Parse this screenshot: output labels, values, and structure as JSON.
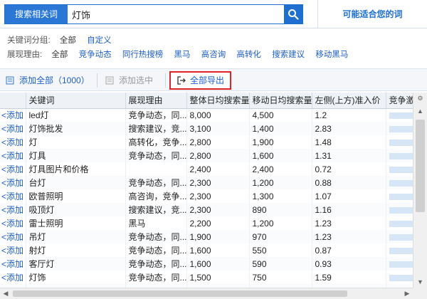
{
  "search": {
    "label": "搜索相关词",
    "value": "灯饰",
    "button_icon": "search-icon"
  },
  "right_tab": {
    "label": "可能适合您的词"
  },
  "filters": {
    "group": {
      "label": "关键词分组:",
      "all": "全部",
      "items": [
        "自定义"
      ]
    },
    "reason": {
      "label": "展现理由:",
      "all": "全部",
      "items": [
        "竞争动态",
        "同行热搜榜",
        "黑马",
        "高咨询",
        "高转化",
        "搜索建议",
        "移动黑马"
      ]
    }
  },
  "toolbar": {
    "add_all": "添加全部（1000）",
    "add_selected": "添加选中",
    "export_all": "全部导出",
    "highlight_color": "#e02424"
  },
  "table": {
    "columns": [
      "关键词",
      "展现理由",
      "整体日均搜索量",
      "移动日均搜索量",
      "左侧(上方)准入价",
      "竞争激烈"
    ],
    "add_label": "<添加",
    "rows": [
      {
        "keyword": "led灯",
        "reason": "竞争动态，同...",
        "total": "8,000",
        "mobile": "4,500",
        "price": "1.2"
      },
      {
        "keyword": "灯饰批发",
        "reason": "搜索建议，竞...",
        "total": "3,100",
        "mobile": "1,400",
        "price": "2.83"
      },
      {
        "keyword": "灯",
        "reason": "高转化，竞争...",
        "total": "2,800",
        "mobile": "1,900",
        "price": "1.48"
      },
      {
        "keyword": "灯具",
        "reason": "竞争动态，同...",
        "total": "2,800",
        "mobile": "1,600",
        "price": "1.31"
      },
      {
        "keyword": "灯具图片和价格",
        "reason": "",
        "total": "2,400",
        "mobile": "2,400",
        "price": "0.72"
      },
      {
        "keyword": "台灯",
        "reason": "竞争动态，同...",
        "total": "2,300",
        "mobile": "1,200",
        "price": "0.88"
      },
      {
        "keyword": "欧普照明",
        "reason": "高咨询，竞争...",
        "total": "2,300",
        "mobile": "1,300",
        "price": "1.07"
      },
      {
        "keyword": "吸顶灯",
        "reason": "搜索建议，竞...",
        "total": "2,300",
        "mobile": "890",
        "price": "1.16"
      },
      {
        "keyword": "雷士照明",
        "reason": "黑马",
        "total": "2,200",
        "mobile": "1,200",
        "price": "1.23"
      },
      {
        "keyword": "吊灯",
        "reason": "竞争动态，同...",
        "total": "1,900",
        "mobile": "970",
        "price": "1.23"
      },
      {
        "keyword": "射灯",
        "reason": "竞争动态，同...",
        "total": "1,600",
        "mobile": "550",
        "price": "0.87"
      },
      {
        "keyword": "客厅灯",
        "reason": "竞争动态，同...",
        "total": "1,600",
        "mobile": "590",
        "price": "0.93"
      },
      {
        "keyword": "灯饰",
        "reason": "竞争动态，同...",
        "total": "1,500",
        "mobile": "750",
        "price": "1.59"
      },
      {
        "keyword": "",
        "reason": "",
        "total": "",
        "mobile": "",
        "price": ""
      }
    ]
  },
  "icons": {
    "add_all": "add-list-icon",
    "add_selected": "add-selected-icon",
    "export": "export-icon",
    "settings": "gear-icon"
  }
}
